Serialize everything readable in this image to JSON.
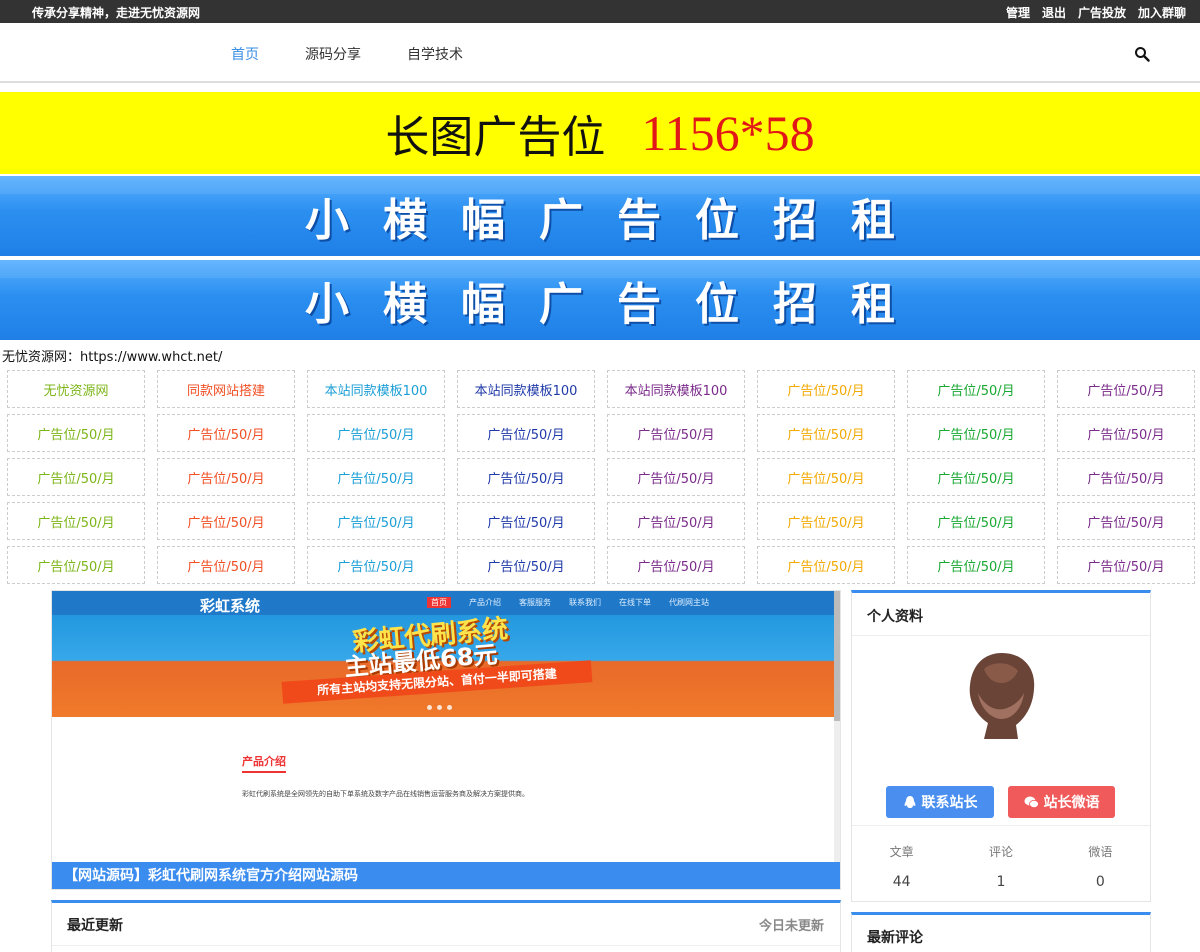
{
  "topbar": {
    "slogan": "传承分享精神，走进无忧资源网",
    "links": [
      "管理",
      "退出",
      "广告投放",
      "加入群聊"
    ]
  },
  "nav": {
    "items": [
      {
        "label": "首页",
        "active": true
      },
      {
        "label": "源码分享",
        "active": false
      },
      {
        "label": "自学技术",
        "active": false
      }
    ],
    "search_icon": "search-icon"
  },
  "banners": {
    "yellow_text": "长图广告位",
    "yellow_size": "1156*58",
    "blue1": "小横幅广告位招租",
    "blue2": "小横幅广告位招租"
  },
  "site_url": "无忧资源网：https://www.whct.net/",
  "ad_grid": {
    "column_colors": [
      "#7cb518",
      "#f04e23",
      "#1a9ed6",
      "#1f3aa8",
      "#7a2a8a",
      "#f2a900",
      "#19a832",
      "#7a2a8a"
    ],
    "rows": [
      [
        "无忧资源网",
        "同款网站搭建",
        "本站同款模板100",
        "本站同款模板100",
        "本站同款模板100",
        "广告位/50/月",
        "广告位/50/月",
        "广告位/50/月"
      ],
      [
        "广告位/50/月",
        "广告位/50/月",
        "广告位/50/月",
        "广告位/50/月",
        "广告位/50/月",
        "广告位/50/月",
        "广告位/50/月",
        "广告位/50/月"
      ],
      [
        "广告位/50/月",
        "广告位/50/月",
        "广告位/50/月",
        "广告位/50/月",
        "广告位/50/月",
        "广告位/50/月",
        "广告位/50/月",
        "广告位/50/月"
      ],
      [
        "广告位/50/月",
        "广告位/50/月",
        "广告位/50/月",
        "广告位/50/月",
        "广告位/50/月",
        "广告位/50/月",
        "广告位/50/月",
        "广告位/50/月"
      ],
      [
        "广告位/50/月",
        "广告位/50/月",
        "广告位/50/月",
        "广告位/50/月",
        "广告位/50/月",
        "广告位/50/月",
        "广告位/50/月",
        "广告位/50/月"
      ]
    ]
  },
  "post": {
    "hero_brand": "彩虹系统",
    "hero_nav": [
      "首页",
      "产品介绍",
      "客服服务",
      "联系我们",
      "在线下单",
      "代刷网主站"
    ],
    "hero_line1": "彩虹代刷系统",
    "hero_line2": "主站最低68元",
    "hero_ribbon": "所有主站均支持无限分站、首付一半即可搭建",
    "section_title": "产品介绍",
    "paragraph": "彩虹代刷系统是全网领先的自助下单系统及数字产品在线销售运营服务商及解决方案提供商。",
    "caption": "【网站源码】彩虹代刷网系统官方介绍网站源码"
  },
  "recent": {
    "title": "最近更新",
    "status": "今日未更新"
  },
  "profile": {
    "title": "个人资料",
    "contact_label": "联系站长",
    "wechat_label": "站长微语",
    "stats": [
      {
        "label": "文章",
        "value": "44"
      },
      {
        "label": "评论",
        "value": "1"
      },
      {
        "label": "微语",
        "value": "0"
      }
    ]
  },
  "comments": {
    "title": "最新评论"
  }
}
